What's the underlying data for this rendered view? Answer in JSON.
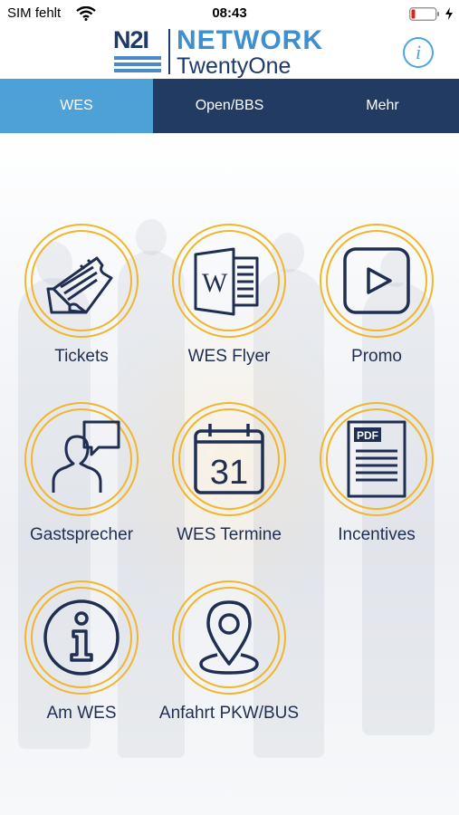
{
  "status_bar": {
    "carrier": "SIM fehlt",
    "time": "08:43"
  },
  "header": {
    "logo_mark": "N2I",
    "logo_title": "NETWORK",
    "logo_subtitle": "TwentyOne",
    "info_label": "i"
  },
  "tabs": [
    {
      "label": "WES",
      "active": true
    },
    {
      "label": "Open/BBS",
      "active": false
    },
    {
      "label": "Mehr",
      "active": false
    }
  ],
  "tiles": [
    {
      "label": "Tickets",
      "icon": "ticket-icon"
    },
    {
      "label": "WES Flyer",
      "icon": "word-document-icon"
    },
    {
      "label": "Promo",
      "icon": "play-icon"
    },
    {
      "label": "Gastsprecher",
      "icon": "speaker-person-icon"
    },
    {
      "label": "WES Termine",
      "icon": "calendar-icon",
      "calendar_day": "31"
    },
    {
      "label": "Incentives",
      "icon": "pdf-document-icon",
      "pdf_label": "PDF"
    },
    {
      "label": "Am WES",
      "icon": "info-icon"
    },
    {
      "label": "Anfahrt PKW/BUS",
      "icon": "location-pin-icon"
    }
  ],
  "colors": {
    "navy": "#1f2f52",
    "tab_active": "#4ea1d6",
    "tab_inactive": "#213b63",
    "ring": "#f0b62c",
    "brand_blue": "#3e8fd0"
  }
}
